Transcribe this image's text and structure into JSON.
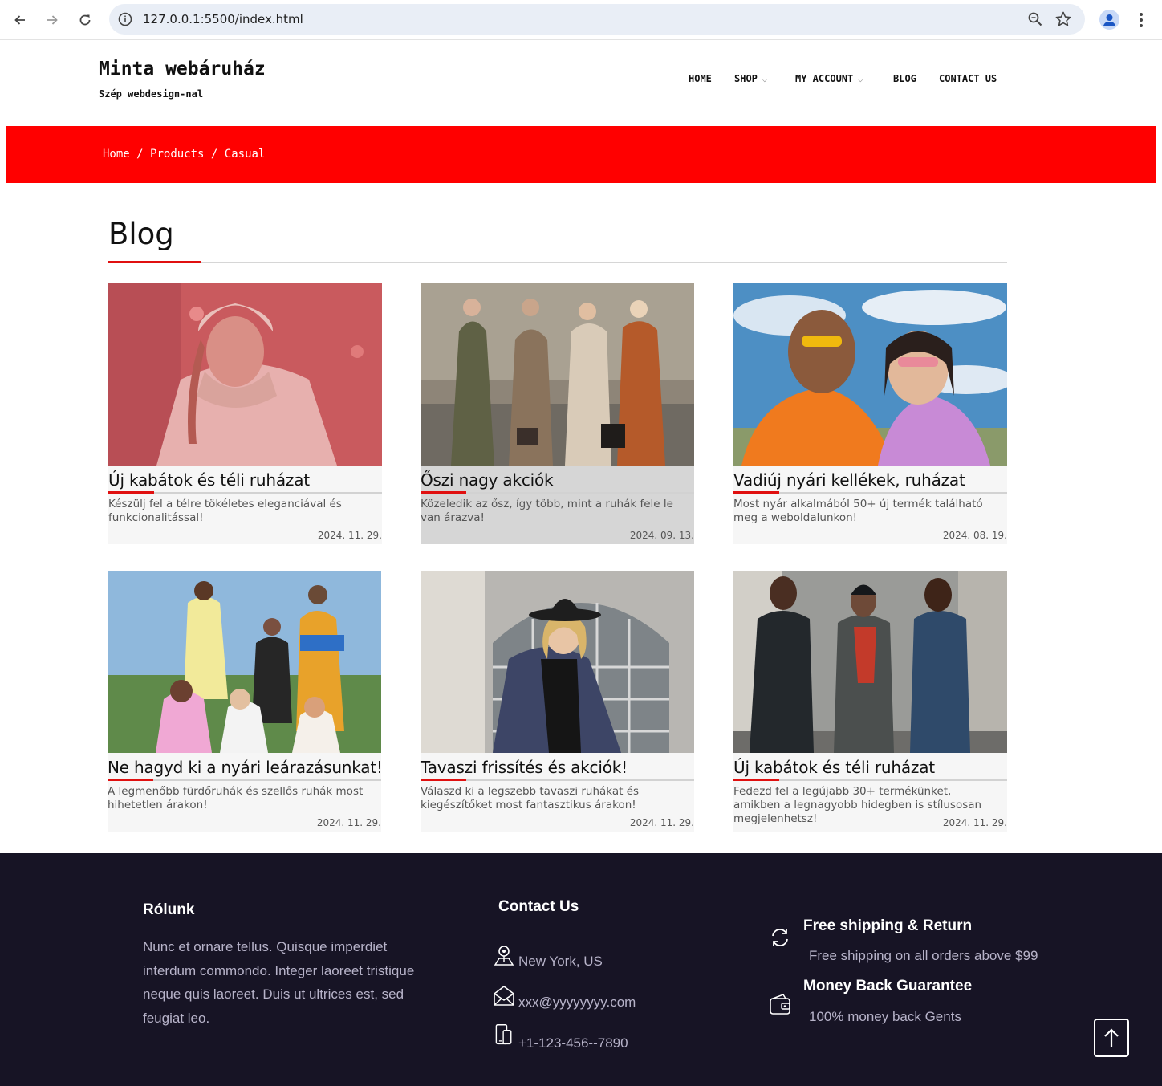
{
  "browser": {
    "url": "127.0.0.1:5500/index.html"
  },
  "header": {
    "title": "Minta webáruház",
    "subtitle": "Szép webdesign-nal",
    "nav": [
      {
        "label": "HOME"
      },
      {
        "label": "SHOP"
      },
      {
        "label": "MY ACCOUNT"
      },
      {
        "label": "BLOG"
      },
      {
        "label": "CONTACT US"
      }
    ]
  },
  "breadcrumb": {
    "items": [
      "Home",
      "Products",
      "Casual"
    ],
    "separator": "/"
  },
  "blog": {
    "heading": "Blog",
    "accent_color": "#e01010",
    "posts": [
      {
        "title": "Új kabátok és téli ruházat",
        "desc": "Készülj fel a télre tökéletes eleganciával és funkcionalitással!",
        "date": "2024. 11. 29."
      },
      {
        "title": "Őszi nagy akciók",
        "desc": "Közeledik az ősz, így több, mint a ruhák fele le van árazva!",
        "date": "2024. 09. 13."
      },
      {
        "title": "Vadiúj nyári kellékek, ruházat",
        "desc": "Most nyár alkalmából 50+ új termék található meg a weboldalunkon!",
        "date": "2024. 08. 19."
      },
      {
        "title": "Ne hagyd ki a nyári leárazásunkat!",
        "desc": "A legmenőbb fürdőruhák és szellős ruhák most hihetetlen árakon!",
        "date": "2024. 11. 29."
      },
      {
        "title": "Tavaszi frissítés és akciók!",
        "desc": "Válaszd ki a legszebb tavaszi ruhákat és kiegészítőket most fantasztikus árakon!",
        "date": "2024. 11. 29."
      },
      {
        "title": "Új kabátok és téli ruházat",
        "desc": "Fedezd fel a legújabb 30+ termékünket, amikben a legnagyobb hidegben is stílusosan megjelenhetsz!",
        "date": "2024. 11. 29."
      }
    ]
  },
  "footer": {
    "about": {
      "title": "Rólunk",
      "text": "Nunc et ornare tellus. Quisque imperdiet interdum commondo. Integer laoreet tristique neque quis laoreet. Duis ut ultrices est, sed feugiat leo."
    },
    "contact": {
      "title": "Contact Us",
      "location": "New York, US",
      "email": "xxx@yyyyyyyy.com",
      "phone": "+1-123-456--7890"
    },
    "features": [
      {
        "title": "Free shipping & Return",
        "text": "Free shipping on all orders above $99",
        "icon": "refresh-icon"
      },
      {
        "title": "Money Back Guarantee",
        "text": "100% money back Gents",
        "icon": "wallet-icon"
      }
    ]
  },
  "colors": {
    "breadcrumb_bg": "#ff0000",
    "footer_bg": "#171425"
  }
}
